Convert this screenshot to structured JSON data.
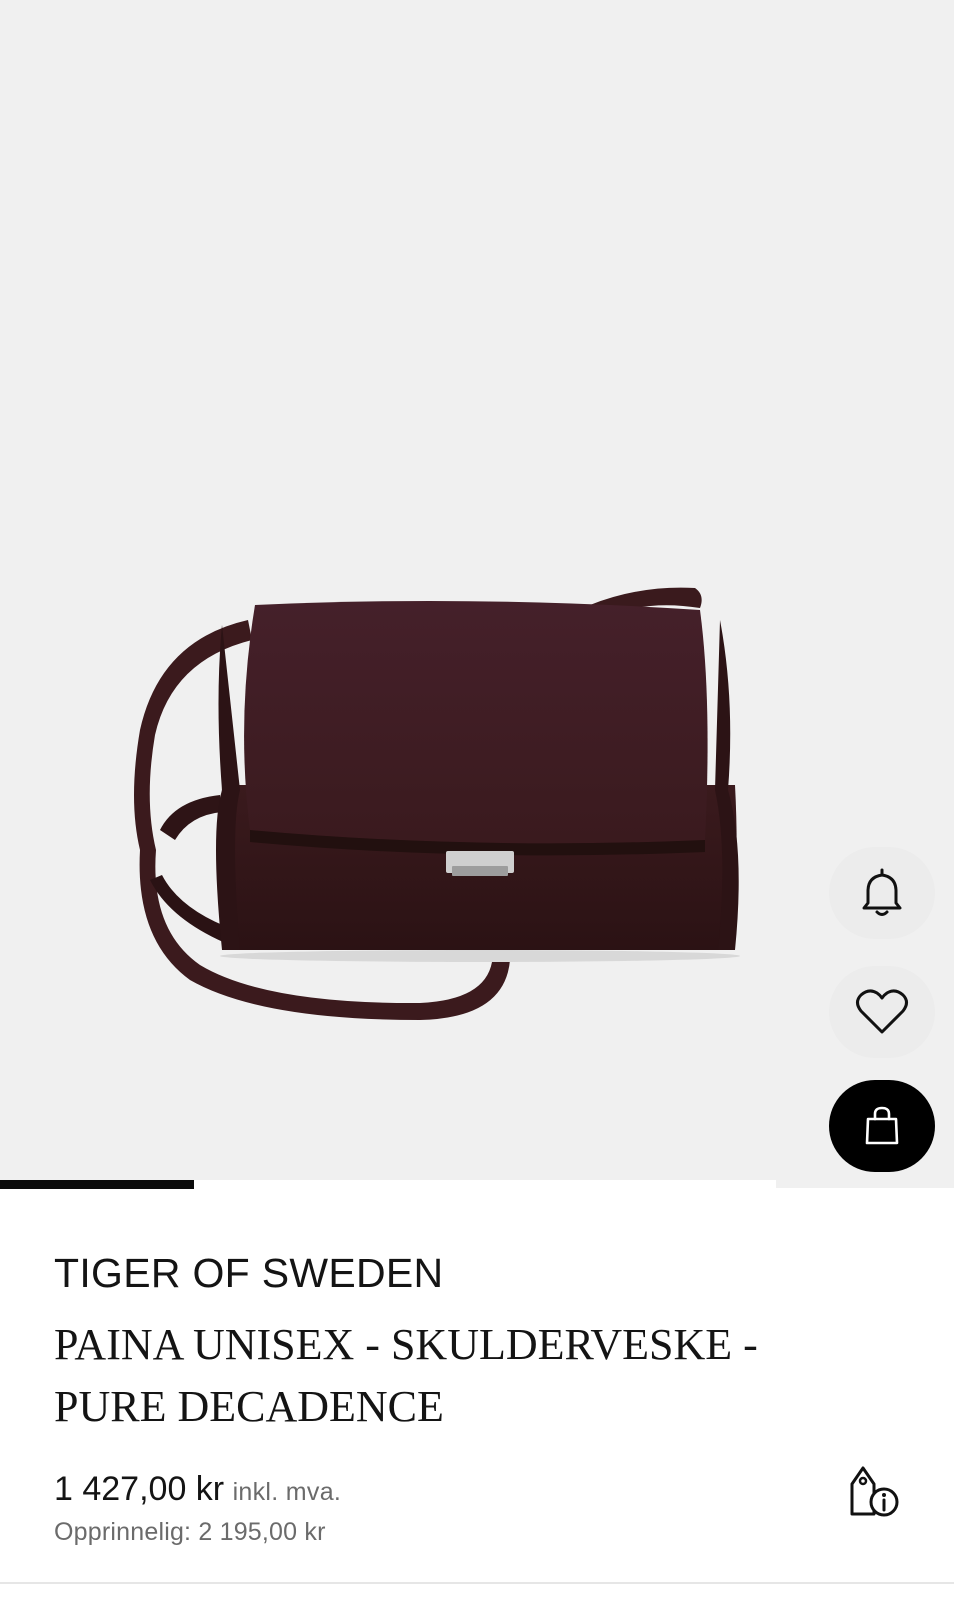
{
  "product": {
    "brand": "TIGER OF SWEDEN",
    "name": "PAINA UNISEX - SKULDERVESKE - PURE DECADENCE",
    "price": "1 427,00 kr",
    "vat_note": "inkl. mva.",
    "original_price": "Opprinnelig: 2 195,00 kr"
  },
  "gallery": {
    "progress_fraction": 0.25
  },
  "icons": {
    "notify": "bell-icon",
    "wishlist": "heart-icon",
    "cart": "shopping-bag-icon",
    "price_info": "price-tag-info-icon"
  },
  "colors": {
    "hero_background": "#f0f0f0",
    "bag_leather": "#3b1a1c",
    "cart_button": "#000000",
    "muted_text": "#6b6b6b"
  }
}
